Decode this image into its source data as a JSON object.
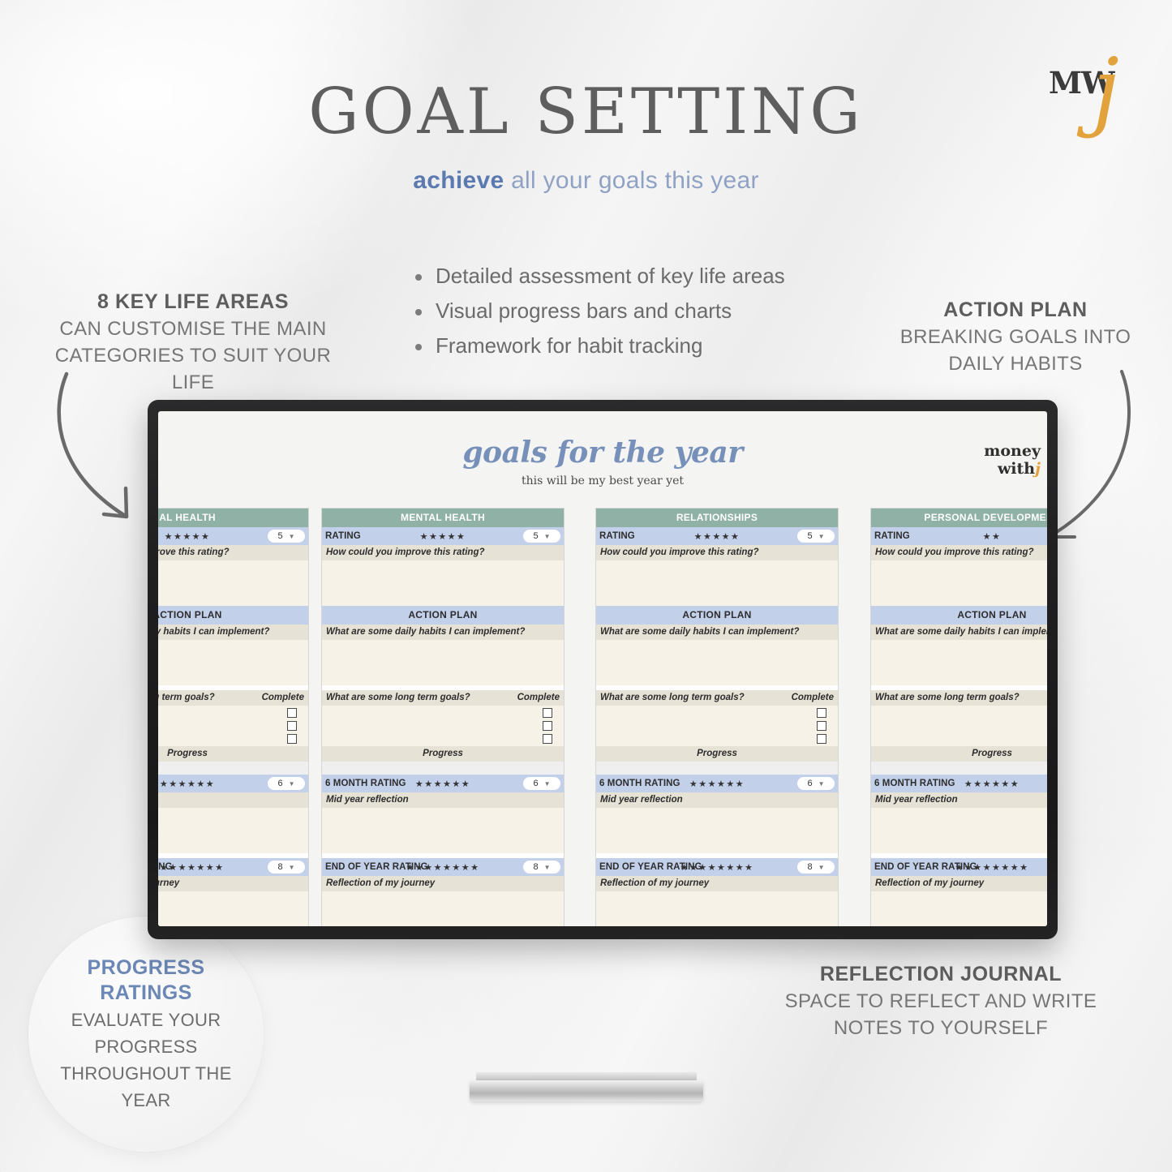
{
  "header": {
    "title": "GOAL SETTING",
    "subtitle_accent": "achieve",
    "subtitle_rest": " all your goals this year"
  },
  "logo": {
    "mark": "MW",
    "script": "j"
  },
  "features": [
    "Detailed assessment of key life areas",
    "Visual progress bars and charts",
    "Framework for habit tracking"
  ],
  "annotations": {
    "left": {
      "heading": "8 KEY LIFE AREAS",
      "line1": "CAN CUSTOMISE THE MAIN",
      "line2": "CATEGORIES TO SUIT YOUR LIFE"
    },
    "right": {
      "heading": "ACTION PLAN",
      "line1": "BREAKING GOALS INTO",
      "line2": "DAILY HABITS"
    },
    "journal": {
      "heading": "REFLECTION JOURNAL",
      "line1": "SPACE TO REFLECT AND WRITE",
      "line2": "NOTES TO YOURSELF"
    },
    "circle": {
      "heading_line1": "PROGRESS",
      "heading_line2": "RATINGS",
      "body_line1": "EVALUATE YOUR",
      "body_line2": "PROGRESS",
      "body_line3": "THROUGHOUT THE",
      "body_line4": "YEAR"
    }
  },
  "spreadsheet": {
    "title": "goals for the year",
    "subtitle": "this will be my best year yet",
    "brand_line1": "money",
    "brand_line2": "with",
    "brand_j": "j",
    "labels": {
      "rating": "RATING",
      "improve_question": "How could you improve this rating?",
      "action_plan": "ACTION PLAN",
      "daily_habits_question": "What are some daily habits I can implement?",
      "long_term_question": "What are some long term goals?",
      "complete": "Complete",
      "progress": "Progress",
      "six_month_rating": "6 MONTH RATING",
      "mid_year_reflection": "Mid year reflection",
      "end_of_year_rating": "END OF YEAR RATING",
      "journey_reflection": "Reflection of my journey"
    },
    "cards": [
      {
        "name": "PHYSICAL HEALTH",
        "visible_name": "AL HEALTH",
        "rating_stars": "★★★★★",
        "rating_value": "5",
        "six_month_stars": "★★★★★★",
        "six_month_value": "6",
        "end_year_stars": "★★★★★★★★",
        "end_year_value": "8"
      },
      {
        "name": "MENTAL HEALTH",
        "visible_name": "MENTAL HEALTH",
        "rating_stars": "★★★★★",
        "rating_value": "5",
        "six_month_stars": "★★★★★★",
        "six_month_value": "6",
        "end_year_stars": "★★★★★★★★",
        "end_year_value": "8"
      },
      {
        "name": "RELATIONSHIPS",
        "visible_name": "RELATIONSHIPS",
        "rating_stars": "★★★★★",
        "rating_value": "5",
        "six_month_stars": "★★★★★★",
        "six_month_value": "6",
        "end_year_stars": "★★★★★★★★",
        "end_year_value": "8"
      },
      {
        "name": "PERSONAL DEVELOPMENT",
        "visible_name": "PERSONAL DEVELOPMENT",
        "rating_stars": "★★",
        "rating_value": "",
        "six_month_stars": "★★★★★★",
        "six_month_value": "",
        "end_year_stars": "★★★★★★★★",
        "end_year_value": ""
      }
    ]
  },
  "colors": {
    "accent_blue": "#6b87b5",
    "header_green": "#8fb1a6",
    "band_blue": "#c3d0ea",
    "question_tan": "#e7e2d6",
    "fill_cream": "#f6f2e8",
    "logo_gold": "#e3a33c"
  }
}
